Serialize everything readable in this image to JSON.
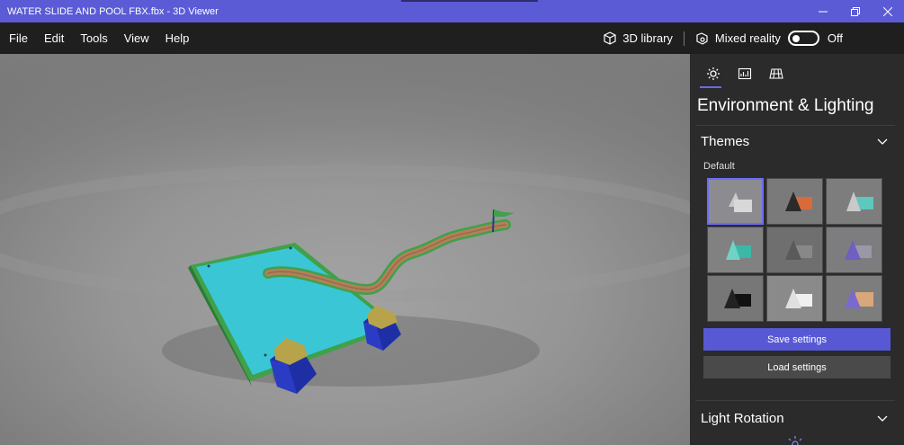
{
  "window": {
    "title": "WATER SLIDE AND POOL FBX.fbx - 3D Viewer"
  },
  "menu": {
    "items": [
      "File",
      "Edit",
      "Tools",
      "View",
      "Help"
    ]
  },
  "toolbar": {
    "library_label": "3D library",
    "mixed_reality_label": "Mixed reality",
    "mixed_reality_state": "Off"
  },
  "panel": {
    "title": "Environment & Lighting",
    "themes_title": "Themes",
    "themes_selected": "Default",
    "save_label": "Save settings",
    "load_label": "Load settings",
    "light_rotation_title": "Light Rotation"
  },
  "colors": {
    "accent": "#5858d4",
    "titlebar": "#5b5bd6"
  }
}
